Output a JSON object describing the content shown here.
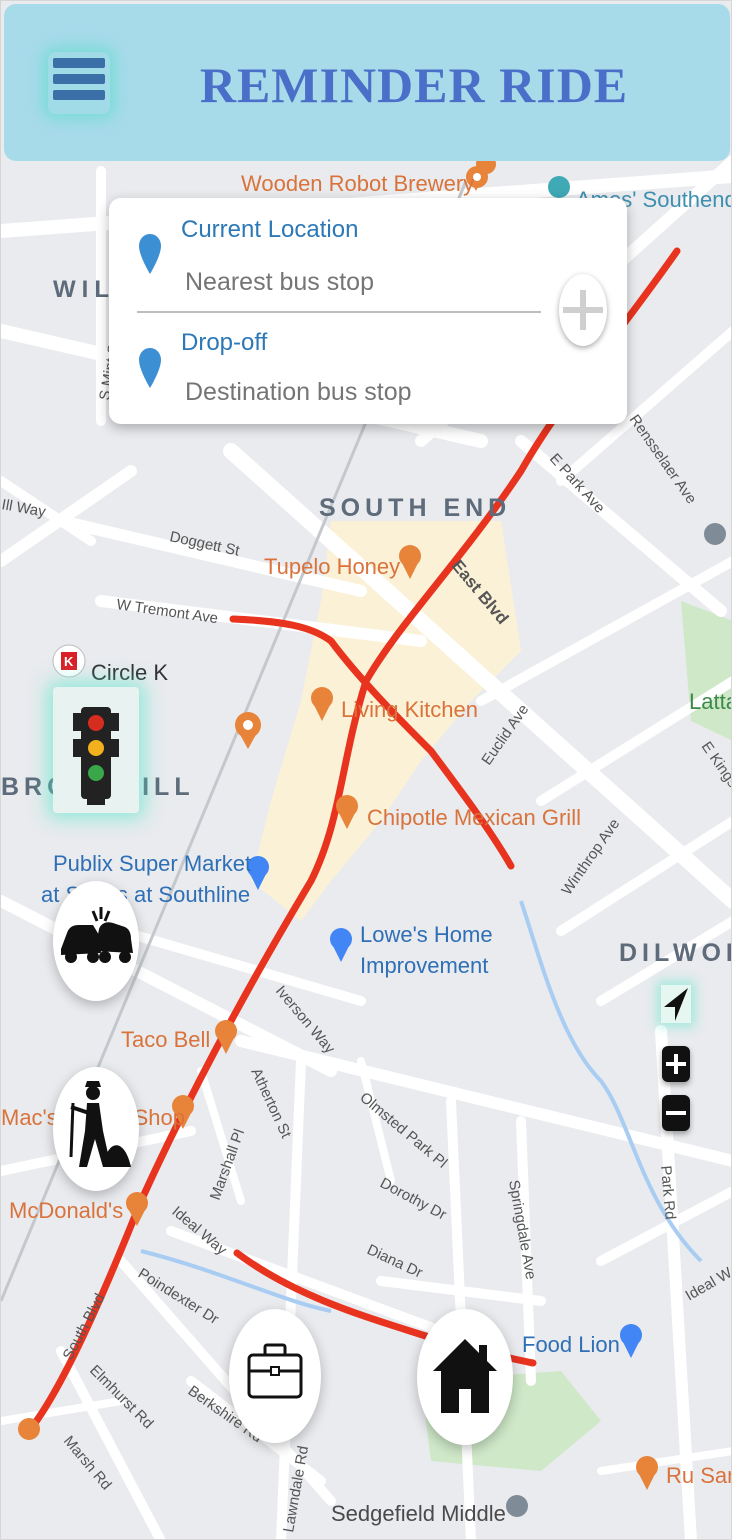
{
  "app": {
    "title": "REMINDER RIDE"
  },
  "route_card": {
    "current_label": "Current Location",
    "current_placeholder": "Nearest bus stop",
    "dropoff_label": "Drop-off",
    "dropoff_placeholder": "Destination bus stop"
  },
  "map": {
    "neighborhoods": [
      "WIL",
      "SOUTH END",
      "BROOKHILL",
      "DILWOR"
    ],
    "places": [
      "Wooden Robot Brewery",
      "Ames' Southend",
      "Tupelo Honey",
      "Living Kitchen",
      "Chipotle Mexican Grill",
      "Circle K",
      "Publix Super Market at Shops at Southline",
      "Lowe's Home Improvement",
      "Taco Bell",
      "Mac's Speed Shop",
      "McDonald's",
      "Food Lion",
      "Sedgefield Middle",
      "Ru San",
      "Latta"
    ],
    "streets": [
      "S Mint St",
      "Doggett St",
      "W Tremont Ave",
      "East Blvd",
      "E Park Ave",
      "Euclid Ave",
      "Winthrop Ave",
      "Iverson Way",
      "Atherton St",
      "Marshall Pl",
      "Olmsted Park Pl",
      "Dorothy Dr",
      "Diana Dr",
      "Springdale Ave",
      "Park Rd",
      "Ideal Way",
      "Poindexter Dr",
      "Elmhurst Rd",
      "Berkshire Rd",
      "Lawndale Rd",
      "Marsh Rd",
      "South Blvd",
      "E Kingston Ave",
      "Rensselaer Ave",
      "Ill Way"
    ]
  },
  "icons": {
    "menu": "hamburger-icon",
    "location_pin": "map-pin-icon",
    "add_stop": "plus-icon",
    "traffic": "traffic-light-icon",
    "accident": "car-crash-icon",
    "construction": "road-work-icon",
    "work": "briefcase-icon",
    "home": "house-icon",
    "locate": "navigation-arrow-icon",
    "zoom_in": "zoom-in-icon",
    "zoom_out": "zoom-out-icon"
  },
  "colors": {
    "header_bg": "#a8dbea",
    "title": "#4a6fc8",
    "label_blue": "#2d78b6",
    "route_red": "#e8331f",
    "map_bg": "#e9ebee",
    "poi_orange": "#e8833a",
    "poi_blue": "#4285f4"
  }
}
